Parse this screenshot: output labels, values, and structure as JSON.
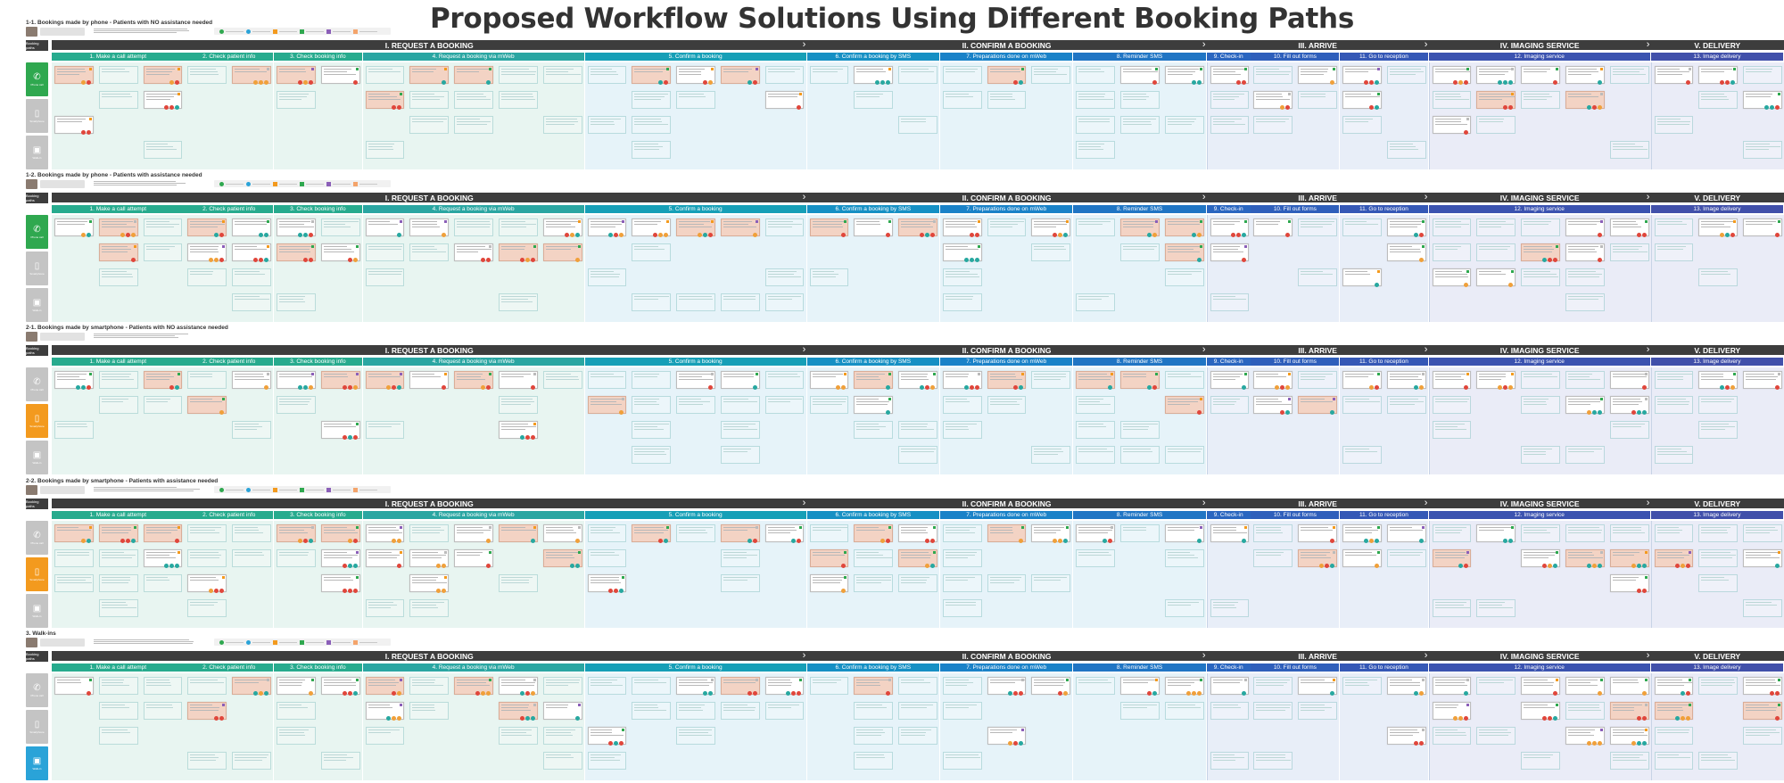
{
  "title": "Proposed Workflow Solutions Using Different Booking Paths",
  "booking_paths_label": "Booking paths",
  "phases": [
    {
      "label": "I.  REQUEST A BOOKING",
      "start": 0,
      "end": 5
    },
    {
      "label": "II.  CONFIRM A BOOKING",
      "start": 5,
      "end": 8
    },
    {
      "label": "III.  ARRIVE",
      "start": 8,
      "end": 11
    },
    {
      "label": "IV.  IMAGING SERVICE",
      "start": 11,
      "end": 12
    },
    {
      "label": "V.  DELIVERY",
      "start": 12,
      "end": 13
    }
  ],
  "steps": [
    {
      "label": "1. Make a call attempt",
      "color": "#27ab8e",
      "cols": 3
    },
    {
      "label": "2. Check patient info",
      "color": "#27ab8e",
      "cols": 2
    },
    {
      "label": "3. Check booking info",
      "color": "#27ab8e",
      "cols": 2
    },
    {
      "label": "4. Request a booking via mWeb",
      "color": "#2aa6a2",
      "cols": 5
    },
    {
      "label": "5. Confirm a booking",
      "color": "#169fb7",
      "cols": 5
    },
    {
      "label": "6. Confirm a booking by SMS",
      "color": "#1690c4",
      "cols": 3
    },
    {
      "label": "7. Preparations done on mWeb",
      "color": "#1a82c8",
      "cols": 3
    },
    {
      "label": "8. Reminder SMS",
      "color": "#2075c4",
      "cols": 3
    },
    {
      "label": "9. Check-in",
      "color": "#2a66c0",
      "cols": 1
    },
    {
      "label": "10. Fill out forms",
      "color": "#2f5fbb",
      "cols": 2
    },
    {
      "label": "11. Go to reception",
      "color": "#3558b6",
      "cols": 2
    },
    {
      "label": "12. Imaging service",
      "color": "#3b53b0",
      "cols": 5
    },
    {
      "label": "13. Image delivery",
      "color": "#4150aa",
      "cols": 3
    }
  ],
  "path_types": {
    "phone": {
      "label": "Phone call",
      "icon": "phone-icon",
      "glyph": "✆"
    },
    "smartphone": {
      "label": "Smartphone",
      "icon": "smartphone-icon",
      "glyph": "▯"
    },
    "walkin": {
      "label": "Walk-in",
      "icon": "walk-in-icon",
      "glyph": "▣"
    }
  },
  "colors": {
    "green": "#2fa84f",
    "orange": "#f39a1e",
    "blue": "#2aa3d8",
    "gray": "#c4c4c4",
    "card_pink": "#f3d3c4",
    "bg_request": "#e8f5f1",
    "bg_confirm": "#e6f3f9",
    "bg_arrive": "#e8eef8",
    "bg_imaging": "#eaecf7"
  },
  "scenarios": [
    {
      "title": "1-1. Bookings made by phone - Patients with NO assistance needed",
      "active_path": "phone",
      "active_color": "green",
      "legend": true
    },
    {
      "title": "1-2. Bookings made by phone - Patients with assistance needed",
      "active_path": "phone",
      "active_color": "green",
      "legend": true
    },
    {
      "title": "2-1. Bookings made by smartphone - Patients with NO assistance needed",
      "active_path": "smartphone",
      "active_color": "orange",
      "legend": false
    },
    {
      "title": "2-2. Bookings made by smartphone - Patients with assistance needed",
      "active_path": "smartphone",
      "active_color": "orange",
      "legend": true
    },
    {
      "title": "3. Walk-ins",
      "active_path": "walkin",
      "active_color": "blue",
      "legend": true
    }
  ]
}
